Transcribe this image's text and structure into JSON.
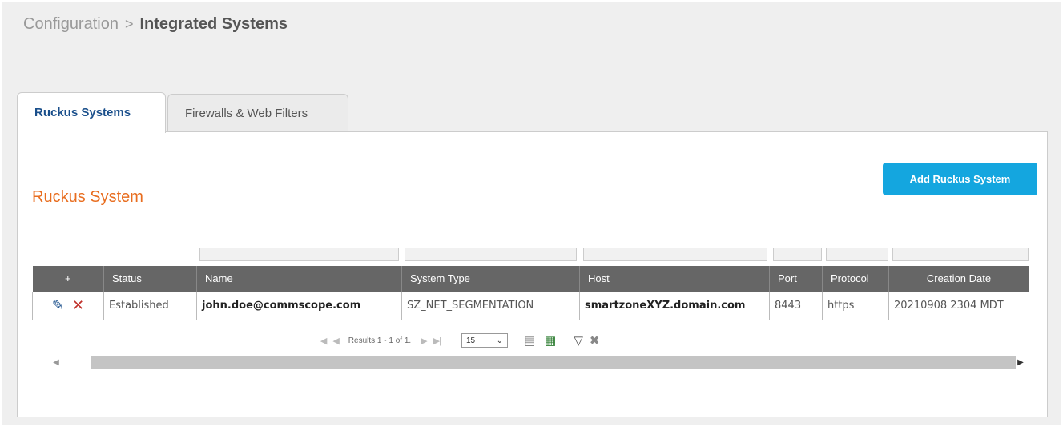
{
  "breadcrumb": {
    "parent": "Configuration",
    "separator": ">",
    "current": "Integrated Systems"
  },
  "tabs": [
    {
      "label": "Ruckus Systems",
      "active": true
    },
    {
      "label": "Firewalls & Web Filters",
      "active": false
    }
  ],
  "section": {
    "title": "Ruckus System",
    "add_button": "Add Ruckus System"
  },
  "table": {
    "headers": {
      "add": "+",
      "status": "Status",
      "name": "Name",
      "system_type": "System Type",
      "host": "Host",
      "port": "Port",
      "protocol": "Protocol",
      "creation_date": "Creation Date"
    },
    "rows": [
      {
        "status": "Established",
        "name": "john.doe@commscope.com",
        "system_type": "SZ_NET_SEGMENTATION",
        "host": "smartzoneXYZ.domain.com",
        "port": "8443",
        "protocol": "https",
        "creation_date": "20210908 2304 MDT"
      }
    ]
  },
  "pager": {
    "results": "Results 1 - 1 of 1.",
    "page_size": "15"
  },
  "colors": {
    "accent": "#14a6df",
    "title": "#e86d1f",
    "active_tab": "#1a4f8b",
    "header": "#666666"
  }
}
